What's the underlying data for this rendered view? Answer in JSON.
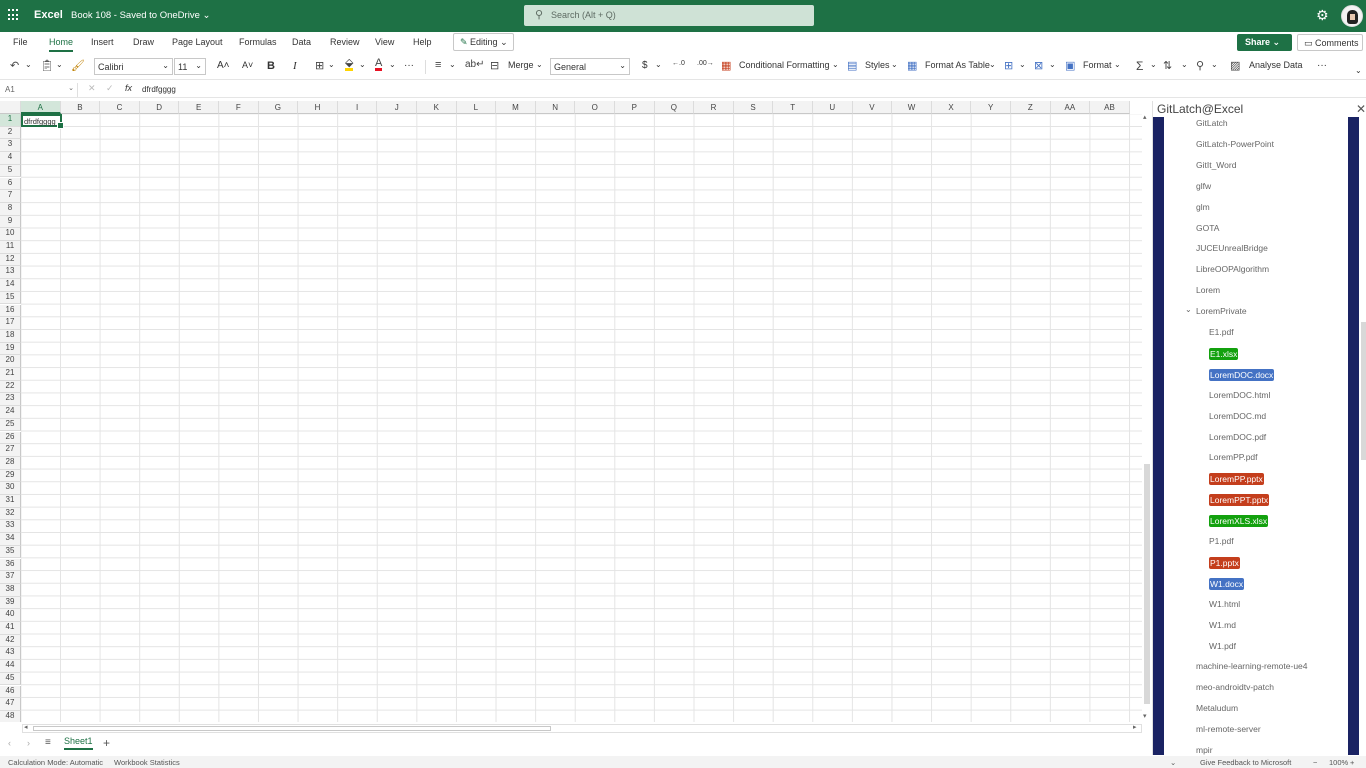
{
  "titlebar": {
    "app_name": "Excel",
    "doc_title": "Book 108 - Saved to OneDrive ⌄",
    "search_placeholder": "Search (Alt + Q)"
  },
  "menu": {
    "tabs": [
      "File",
      "Home",
      "Insert",
      "Draw",
      "Page Layout",
      "Formulas",
      "Data",
      "Review",
      "View",
      "Help"
    ],
    "active_tab": "Home",
    "editing_label": "Editing",
    "share_label": "Share",
    "comments_label": "Comments"
  },
  "toolbar": {
    "font_name": "Calibri",
    "font_size": "11",
    "bold": "B",
    "italic": "I",
    "merge_label": "Merge",
    "number_format": "General",
    "currency": "$",
    "conditional_formatting": "Conditional Formatting",
    "styles": "Styles",
    "format_as_table": "Format As Table",
    "format": "Format",
    "analyse_data": "Analyse Data",
    "more": "···"
  },
  "formula_bar": {
    "name_box": "A1",
    "fx": "fx",
    "content": "dfrdfgggg"
  },
  "grid": {
    "columns": [
      "A",
      "B",
      "C",
      "D",
      "E",
      "F",
      "G",
      "H",
      "I",
      "J",
      "K",
      "L",
      "M",
      "N",
      "O",
      "P",
      "Q",
      "R",
      "S",
      "T",
      "U",
      "V",
      "W",
      "X",
      "Y",
      "Z",
      "AA",
      "AB"
    ],
    "row_count": 48,
    "active_cell_value": "dfrdfgggg"
  },
  "sheets": {
    "tabs": [
      "Sheet1"
    ],
    "add": "+"
  },
  "status": {
    "calc_mode": "Calculation Mode: Automatic",
    "workbook_stats": "Workbook Statistics",
    "feedback": "Give Feedback to Microsoft",
    "zoom": "100%"
  },
  "pane": {
    "title": "GitLatch@Excel",
    "items": [
      {
        "label": "GitLatch",
        "level": 0
      },
      {
        "label": "GitLatch-PowerPoint",
        "level": 0
      },
      {
        "label": "GitIt_Word",
        "level": 0
      },
      {
        "label": "glfw",
        "level": 0
      },
      {
        "label": "glm",
        "level": 0
      },
      {
        "label": "GOTA",
        "level": 0
      },
      {
        "label": "JUCEUnrealBridge",
        "level": 0
      },
      {
        "label": "LibreOOPAlgorithm",
        "level": 0
      },
      {
        "label": "Lorem",
        "level": 0
      },
      {
        "label": "LoremPrivate",
        "level": 0,
        "expanded": true
      },
      {
        "label": "E1.pdf",
        "level": 1
      },
      {
        "label": "E1.xlsx",
        "level": 1,
        "color": "#13a10e"
      },
      {
        "label": "LoremDOC.docx",
        "level": 1,
        "color": "#4472c4"
      },
      {
        "label": "LoremDOC.html",
        "level": 1
      },
      {
        "label": "LoremDOC.md",
        "level": 1
      },
      {
        "label": "LoremDOC.pdf",
        "level": 1
      },
      {
        "label": "LoremPP.pdf",
        "level": 1
      },
      {
        "label": "LoremPP.pptx",
        "level": 1,
        "color": "#c43e1c"
      },
      {
        "label": "LoremPPT.pptx",
        "level": 1,
        "color": "#c43e1c"
      },
      {
        "label": "LoremXLS.xlsx",
        "level": 1,
        "color": "#13a10e"
      },
      {
        "label": "P1.pdf",
        "level": 1
      },
      {
        "label": "P1.pptx",
        "level": 1,
        "color": "#c43e1c"
      },
      {
        "label": "W1.docx",
        "level": 1,
        "color": "#4472c4"
      },
      {
        "label": "W1.html",
        "level": 1
      },
      {
        "label": "W1.md",
        "level": 1
      },
      {
        "label": "W1.pdf",
        "level": 1
      },
      {
        "label": "machine-learning-remote-ue4",
        "level": 0
      },
      {
        "label": "meo-androidtv-patch",
        "level": 0
      },
      {
        "label": "Metaludum",
        "level": 0
      },
      {
        "label": "ml-remote-server",
        "level": 0
      },
      {
        "label": "mpir",
        "level": 0
      }
    ]
  }
}
